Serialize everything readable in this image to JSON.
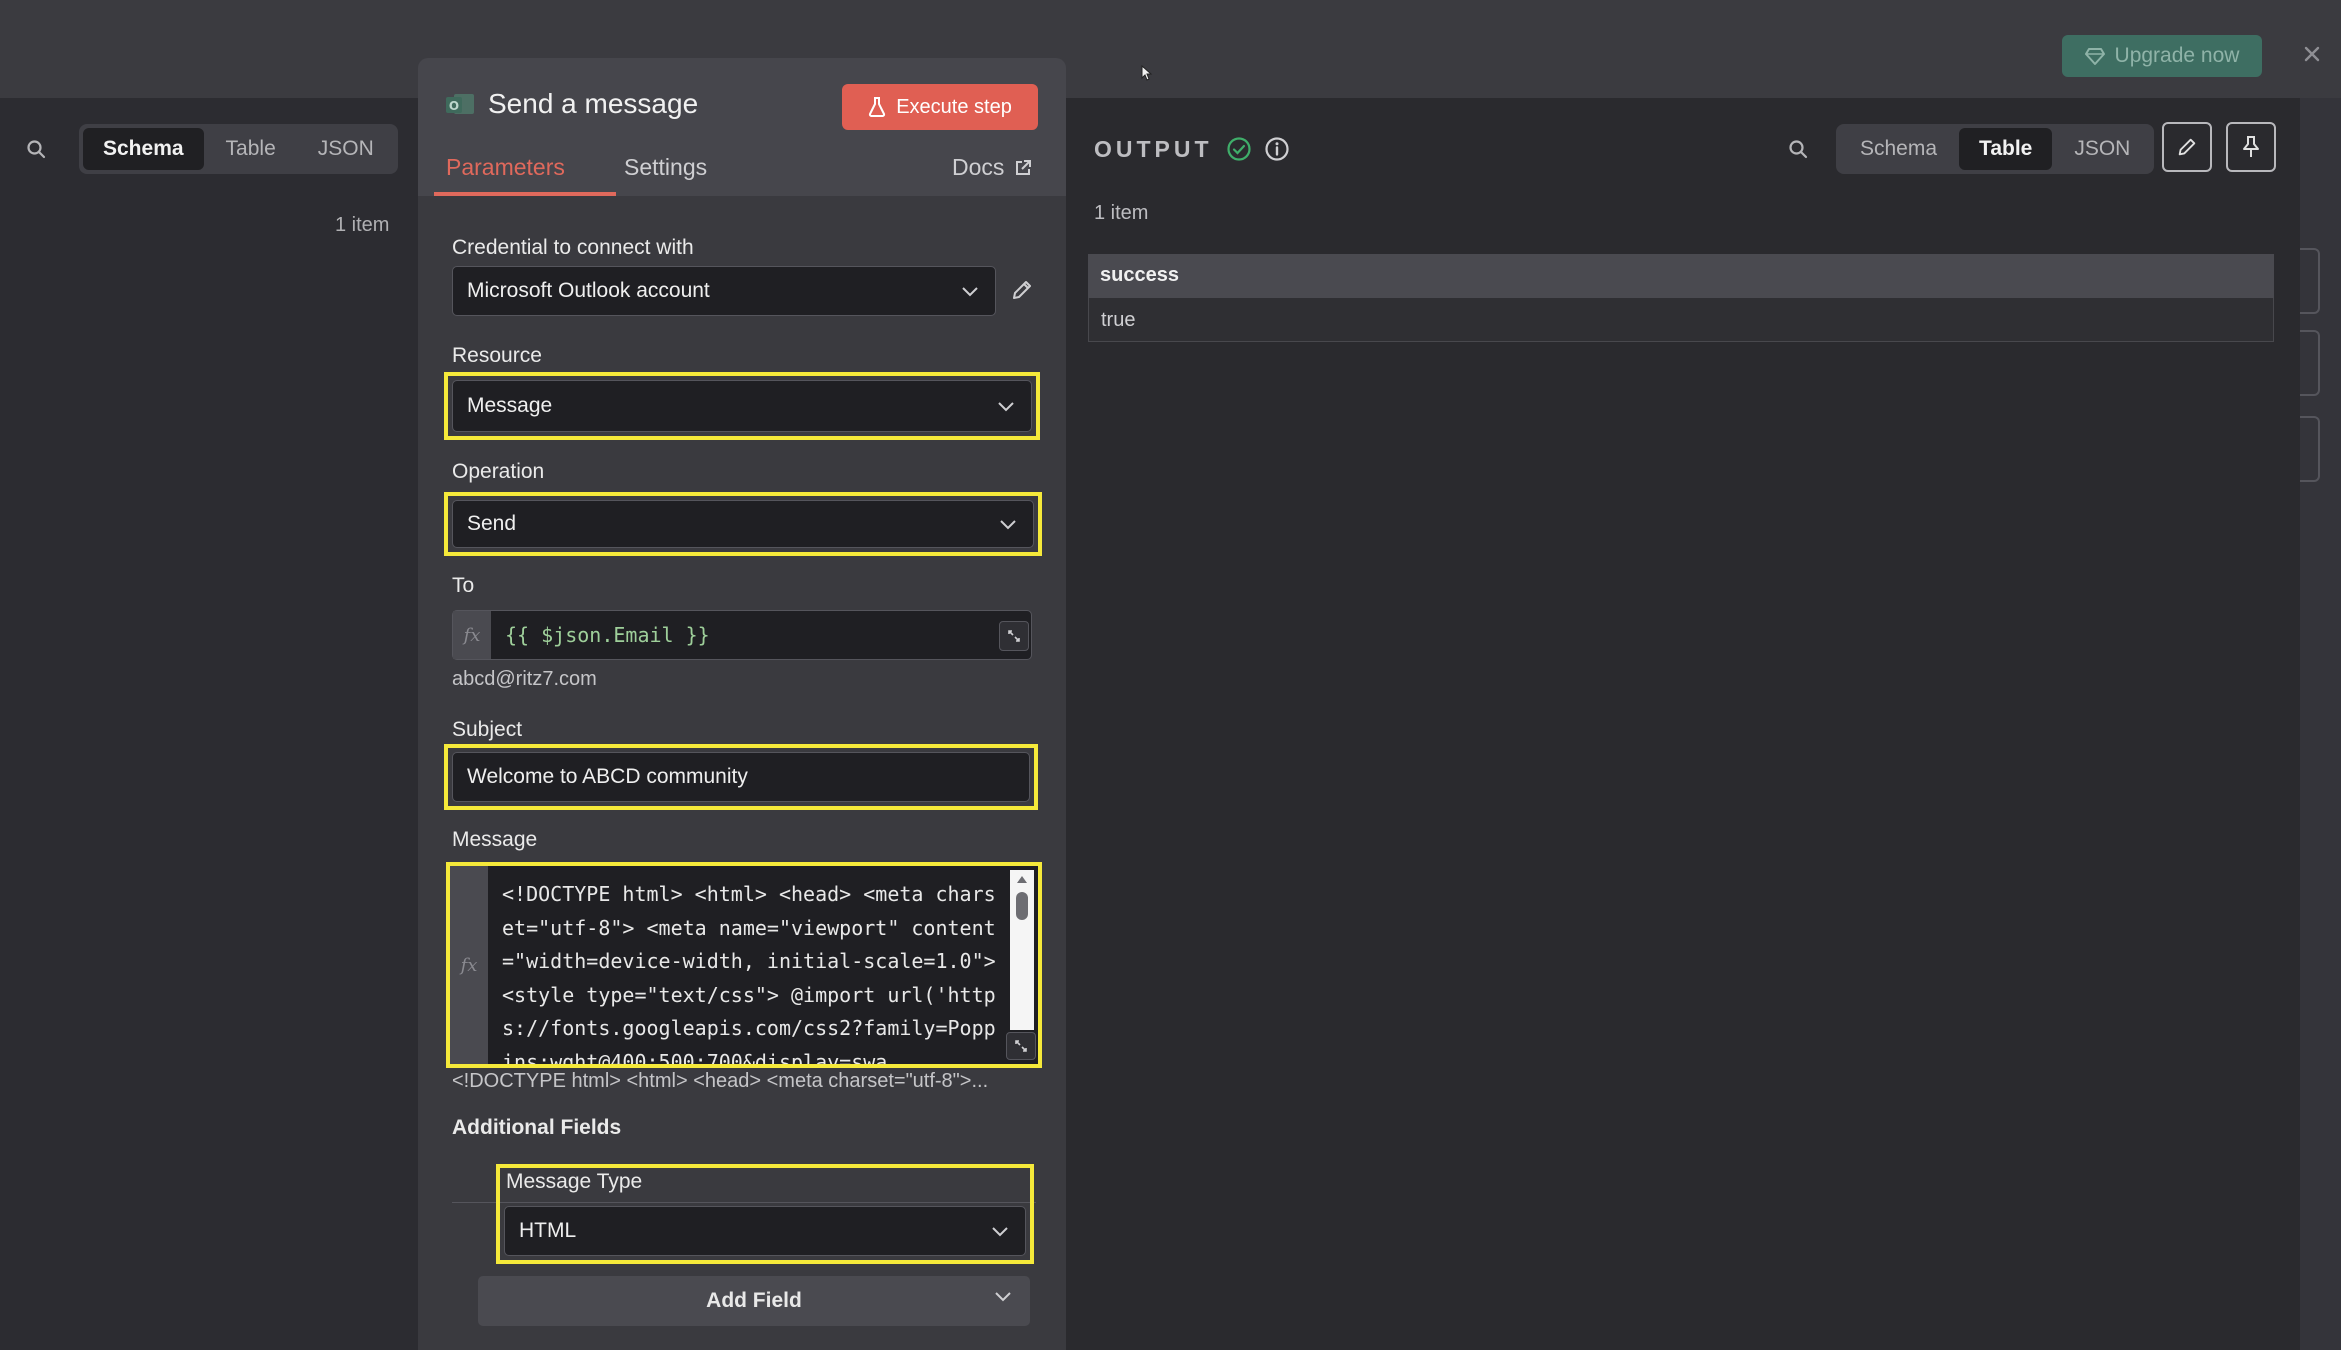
{
  "topbar": {
    "upgrade_label": "Upgrade now"
  },
  "input_panel": {
    "view_tabs": [
      "Schema",
      "Table",
      "JSON"
    ],
    "active_tab": "Schema",
    "item_count": "1 item"
  },
  "node": {
    "title": "Send a message",
    "execute_label": "Execute step",
    "tabs": {
      "parameters": "Parameters",
      "settings": "Settings",
      "docs": "Docs"
    },
    "credential": {
      "label": "Credential to connect with",
      "value": "Microsoft Outlook account"
    },
    "resource": {
      "label": "Resource",
      "value": "Message"
    },
    "operation": {
      "label": "Operation",
      "value": "Send"
    },
    "to": {
      "label": "To",
      "fx": "fx",
      "expression": "{{ $json.Email }}",
      "preview": "abcd@ritz7.com"
    },
    "subject": {
      "label": "Subject",
      "value": "Welcome to ABCD community"
    },
    "message": {
      "label": "Message",
      "fx": "fx",
      "code": "<!DOCTYPE html> <html> <head> <meta charset=\"utf-8\"> <meta name=\"viewport\" content=\"width=device-width, initial-scale=1.0\"> <style type=\"text/css\"> @import url('https://fonts.googleapis.com/css2?family=Poppins:wght@400;500;700&display=swa",
      "preview": "<!DOCTYPE html> <html> <head> <meta charset=\"utf-8\">..."
    },
    "additional_fields": {
      "label": "Additional Fields",
      "message_type": {
        "label": "Message Type",
        "value": "HTML"
      },
      "add_field_label": "Add Field"
    }
  },
  "output": {
    "title": "OUTPUT",
    "view_tabs": [
      "Schema",
      "Table",
      "JSON"
    ],
    "active_tab": "Table",
    "item_count": "1 item",
    "table": {
      "headers": [
        "success"
      ],
      "rows": [
        [
          "true"
        ]
      ]
    }
  },
  "colors": {
    "accent": "#e05f53",
    "highlight": "#f5e93a",
    "success": "#3fae6a",
    "upgrade": "#3e6e62"
  }
}
